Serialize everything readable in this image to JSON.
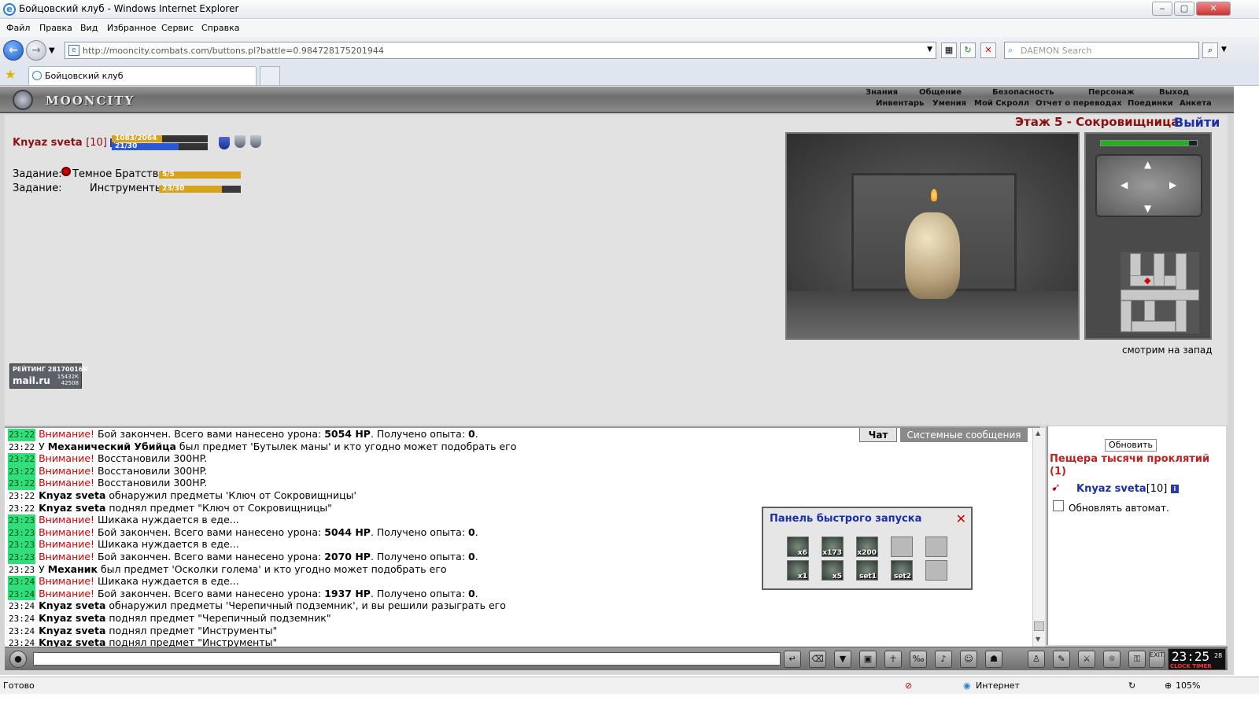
{
  "window": {
    "title": "Бойцовский клуб - Windows Internet Explorer",
    "btn_min": "‒",
    "btn_max": "▢",
    "btn_close": "✕"
  },
  "menu": [
    "Файл",
    "Правка",
    "Вид",
    "Избранное",
    "Сервис",
    "Справка"
  ],
  "address": {
    "url": "http://mooncity.combats.com/buttons.pl?battle=0.984728175201944"
  },
  "search": {
    "placeholder": "DAEMON Search"
  },
  "tab": {
    "title": "Бойцовский клуб"
  },
  "game": {
    "logo": "MOONCITY",
    "top_nav": [
      "Знания",
      "Общение",
      "Безопасность",
      "Персонаж",
      "Выход"
    ],
    "sub_nav": [
      "Инвентарь",
      "Умения",
      "Мой Скролл",
      "Отчет о переводах",
      "Поединки",
      "Анкета"
    ],
    "player": {
      "name": "Knyaz sveta",
      "level": "[10]",
      "hp_text": "1083/2064",
      "hp_fraction": 0.525,
      "mana_text": "21/30",
      "mana_fraction": 0.7
    },
    "quests": [
      {
        "label": "Задание:",
        "name": "Темное Братство",
        "progress": "5/5",
        "fraction": 1.0
      },
      {
        "label": "Задание:",
        "name": "Инструменты",
        "progress": "23/30",
        "fraction": 0.767
      }
    ],
    "floor_title": "Этаж 5 - Сокровищница",
    "exit_link": "Выйти",
    "facing": "смотрим на запад",
    "hp_map_fraction": 0.92,
    "rating": {
      "line1": "РЕЙТИНГ 28170016К",
      "brand": "mail.ru",
      "n1": "15432К",
      "n2": "42508"
    }
  },
  "chat": {
    "tabs": [
      "Чат",
      "Системные сообщения"
    ],
    "lines": [
      {
        "t": "23:22",
        "hl": true,
        "parts": [
          {
            "c": "warn",
            "s": "Внимание!"
          },
          {
            "s": " Бой закончен. Всего вами нанесено урона: "
          },
          {
            "c": "nm",
            "s": "5054 HP"
          },
          {
            "s": ". Получено опыта: "
          },
          {
            "c": "nm",
            "s": "0"
          },
          {
            "s": "."
          }
        ]
      },
      {
        "t": "23:22",
        "hl": false,
        "parts": [
          {
            "s": "У "
          },
          {
            "c": "nm",
            "s": "Механический Убийца"
          },
          {
            "s": " был предмет 'Бутылек маны' и кто угодно может подобрать его"
          }
        ]
      },
      {
        "t": "23:22",
        "hl": true,
        "parts": [
          {
            "c": "warn",
            "s": "Внимание!"
          },
          {
            "s": " Восстановили 300HP."
          }
        ]
      },
      {
        "t": "23:22",
        "hl": true,
        "parts": [
          {
            "c": "warn",
            "s": "Внимание!"
          },
          {
            "s": " Восстановили 300HP."
          }
        ]
      },
      {
        "t": "23:22",
        "hl": true,
        "parts": [
          {
            "c": "warn",
            "s": "Внимание!"
          },
          {
            "s": " Восстановили 300HP."
          }
        ]
      },
      {
        "t": "23:22",
        "hl": false,
        "parts": [
          {
            "c": "nm",
            "s": "Knyaz sveta"
          },
          {
            "s": " обнаружил предметы 'Ключ от Сокровищницы'"
          }
        ]
      },
      {
        "t": "23:22",
        "hl": false,
        "parts": [
          {
            "c": "nm",
            "s": "Knyaz sveta"
          },
          {
            "s": " поднял предмет \"Ключ от Сокровищницы\""
          }
        ]
      },
      {
        "t": "23:23",
        "hl": true,
        "parts": [
          {
            "c": "warn",
            "s": "Внимание!"
          },
          {
            "s": " Шикака нуждается в еде..."
          }
        ]
      },
      {
        "t": "23:23",
        "hl": true,
        "parts": [
          {
            "c": "warn",
            "s": "Внимание!"
          },
          {
            "s": " Бой закончен. Всего вами нанесено урона: "
          },
          {
            "c": "nm",
            "s": "5044 HP"
          },
          {
            "s": ". Получено опыта: "
          },
          {
            "c": "nm",
            "s": "0"
          },
          {
            "s": "."
          }
        ]
      },
      {
        "t": "23:23",
        "hl": true,
        "parts": [
          {
            "c": "warn",
            "s": "Внимание!"
          },
          {
            "s": " Шикака нуждается в еде..."
          }
        ]
      },
      {
        "t": "23:23",
        "hl": true,
        "parts": [
          {
            "c": "warn",
            "s": "Внимание!"
          },
          {
            "s": " Бой закончен. Всего вами нанесено урона: "
          },
          {
            "c": "nm",
            "s": "2070 HP"
          },
          {
            "s": ". Получено опыта: "
          },
          {
            "c": "nm",
            "s": "0"
          },
          {
            "s": "."
          }
        ]
      },
      {
        "t": "23:23",
        "hl": false,
        "parts": [
          {
            "s": "У "
          },
          {
            "c": "nm",
            "s": "Механик"
          },
          {
            "s": " был предмет 'Осколки голема' и кто угодно может подобрать его"
          }
        ]
      },
      {
        "t": "23:24",
        "hl": true,
        "parts": [
          {
            "c": "warn",
            "s": "Внимание!"
          },
          {
            "s": " Шикака нуждается в еде..."
          }
        ]
      },
      {
        "t": "23:24",
        "hl": true,
        "parts": [
          {
            "c": "warn",
            "s": "Внимание!"
          },
          {
            "s": " Бой закончен. Всего вами нанесено урона: "
          },
          {
            "c": "nm",
            "s": "1937 HP"
          },
          {
            "s": ". Получено опыта: "
          },
          {
            "c": "nm",
            "s": "0"
          },
          {
            "s": "."
          }
        ]
      },
      {
        "t": "23:24",
        "hl": false,
        "parts": [
          {
            "c": "nm",
            "s": "Knyaz sveta"
          },
          {
            "s": " обнаружил предметы 'Черепичный подземник', и вы решили разыграть его"
          }
        ]
      },
      {
        "t": "23:24",
        "hl": false,
        "parts": [
          {
            "c": "nm",
            "s": "Knyaz sveta"
          },
          {
            "s": " поднял предмет \"Черепичный подземник\""
          }
        ]
      },
      {
        "t": "23:24",
        "hl": false,
        "parts": [
          {
            "c": "nm",
            "s": "Knyaz sveta"
          },
          {
            "s": " поднял предмет \"Инструменты\""
          }
        ]
      },
      {
        "t": "23:24",
        "hl": false,
        "parts": [
          {
            "c": "nm",
            "s": "Knyaz sveta"
          },
          {
            "s": " поднял предмет \"Инструменты\""
          }
        ]
      }
    ]
  },
  "quick_panel": {
    "title": "Панель быстрого запуска",
    "close": "✕",
    "slots": [
      {
        "label": "x6",
        "dim": false
      },
      {
        "label": "x173",
        "dim": false
      },
      {
        "label": "x200",
        "dim": false
      },
      {
        "label": "",
        "dim": true
      },
      {
        "label": "",
        "dim": true
      },
      {
        "label": "x1",
        "dim": false
      },
      {
        "label": "x5",
        "dim": false
      },
      {
        "label": "set1",
        "dim": false
      },
      {
        "label": "set2",
        "dim": false
      },
      {
        "label": "",
        "dim": true
      }
    ]
  },
  "right_panel": {
    "refresh": "Обновить",
    "location": "Пещера тысячи проклятий (1)",
    "user": "Knyaz sveta",
    "user_level": "[10]",
    "auto_label": "Обновлять автомат."
  },
  "clock": {
    "time": "23:25",
    "sec": "28",
    "label": "CLOCK TIMER"
  },
  "status": {
    "left": "Готово",
    "zone": "Интернет",
    "zoom": "105%"
  }
}
